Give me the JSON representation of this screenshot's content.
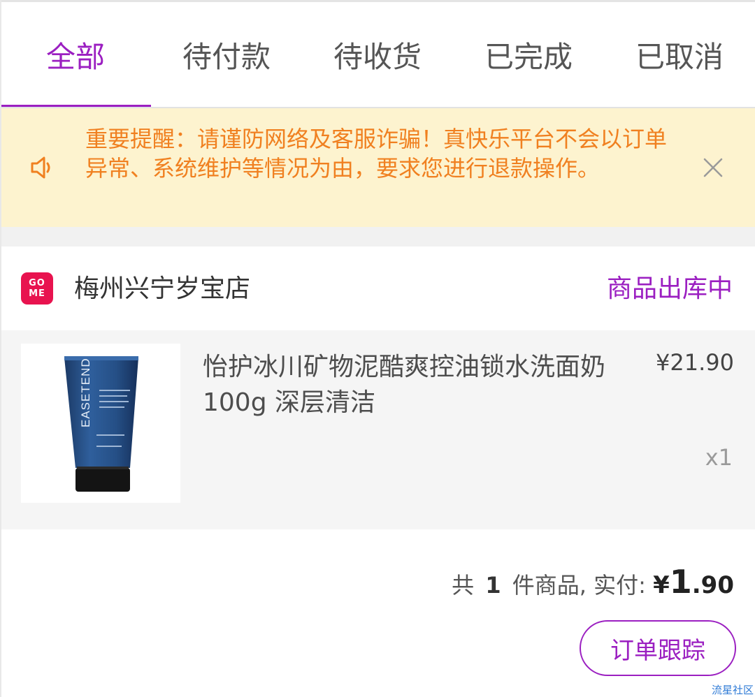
{
  "tabs": [
    {
      "label": "全部",
      "active": true
    },
    {
      "label": "待付款",
      "active": false
    },
    {
      "label": "待收货",
      "active": false
    },
    {
      "label": "已完成",
      "active": false
    },
    {
      "label": "已取消",
      "active": false
    }
  ],
  "notice": {
    "text": "重要提醒：请谨防网络及客服诈骗！真快乐平台不会以订单异常、系统维护等情况为由，要求您进行退款操作。",
    "icon": "speaker-icon",
    "close_icon": "close-icon"
  },
  "order": {
    "store": {
      "logo_text_top": "GO",
      "logo_text_bottom": "ME",
      "name": "梅州兴宁岁宝店"
    },
    "status": "商品出库中",
    "item": {
      "title": "怡护冰川矿物泥酷爽控油锁水洗面奶100g 深层清洁",
      "price": "¥21.90",
      "quantity": "x1",
      "image_brand": "EASETEND"
    },
    "summary": {
      "prefix": "共",
      "count": "1",
      "suffix": "件商品, 实付:",
      "currency": "¥",
      "paid_int": "1",
      "paid_dec": ".90"
    },
    "track_button": "订单跟踪"
  },
  "watermark": "流星社区",
  "colors": {
    "accent": "#9b1fc1",
    "notice_bg": "#fdf3cf",
    "notice_text": "#f08020",
    "logo_red": "#e8134f"
  }
}
